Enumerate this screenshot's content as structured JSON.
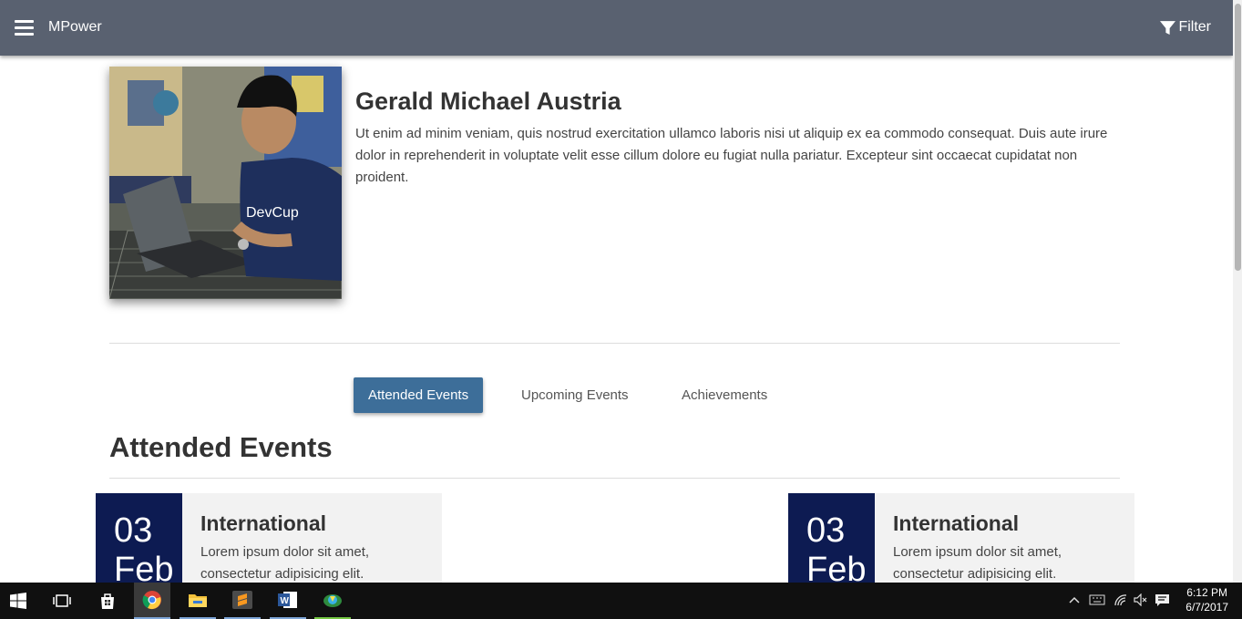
{
  "appbar": {
    "brand": "MPower",
    "filter_label": "Filter"
  },
  "profile": {
    "name": "Gerald Michael Austria",
    "bio": "Ut enim ad minim veniam, quis nostrud exercitation ullamco laboris nisi ut aliquip ex ea commodo consequat. Duis aute irure dolor in reprehenderit in voluptate velit esse cillum dolore eu fugiat nulla pariatur. Excepteur sint occaecat cupidatat non proident.",
    "shirt_text": "DevCup"
  },
  "tabs": [
    {
      "label": "Attended Events",
      "active": true
    },
    {
      "label": "Upcoming Events",
      "active": false
    },
    {
      "label": "Achievements",
      "active": false
    }
  ],
  "section_title": "Attended Events",
  "events": [
    {
      "day": "03",
      "month": "Feb",
      "title": "International",
      "desc": "Lorem ipsum dolor sit amet, consectetur adipisicing elit."
    },
    {
      "day": "03",
      "month": "Feb",
      "title": "International",
      "desc": "Lorem ipsum dolor sit amet, consectetur adipisicing elit."
    }
  ],
  "colors": {
    "appbar": "#596170",
    "accent": "#3d6e99",
    "date_block": "#0d1b52",
    "card_bg": "#f2f2f2"
  },
  "taskbar": {
    "icons": [
      "windows-start-icon",
      "task-view-icon",
      "store-icon",
      "chrome-icon",
      "file-explorer-icon",
      "sublime-text-icon",
      "word-icon",
      "downloader-icon"
    ],
    "clock_time": "6:12 PM",
    "clock_date": "6/7/2017"
  }
}
